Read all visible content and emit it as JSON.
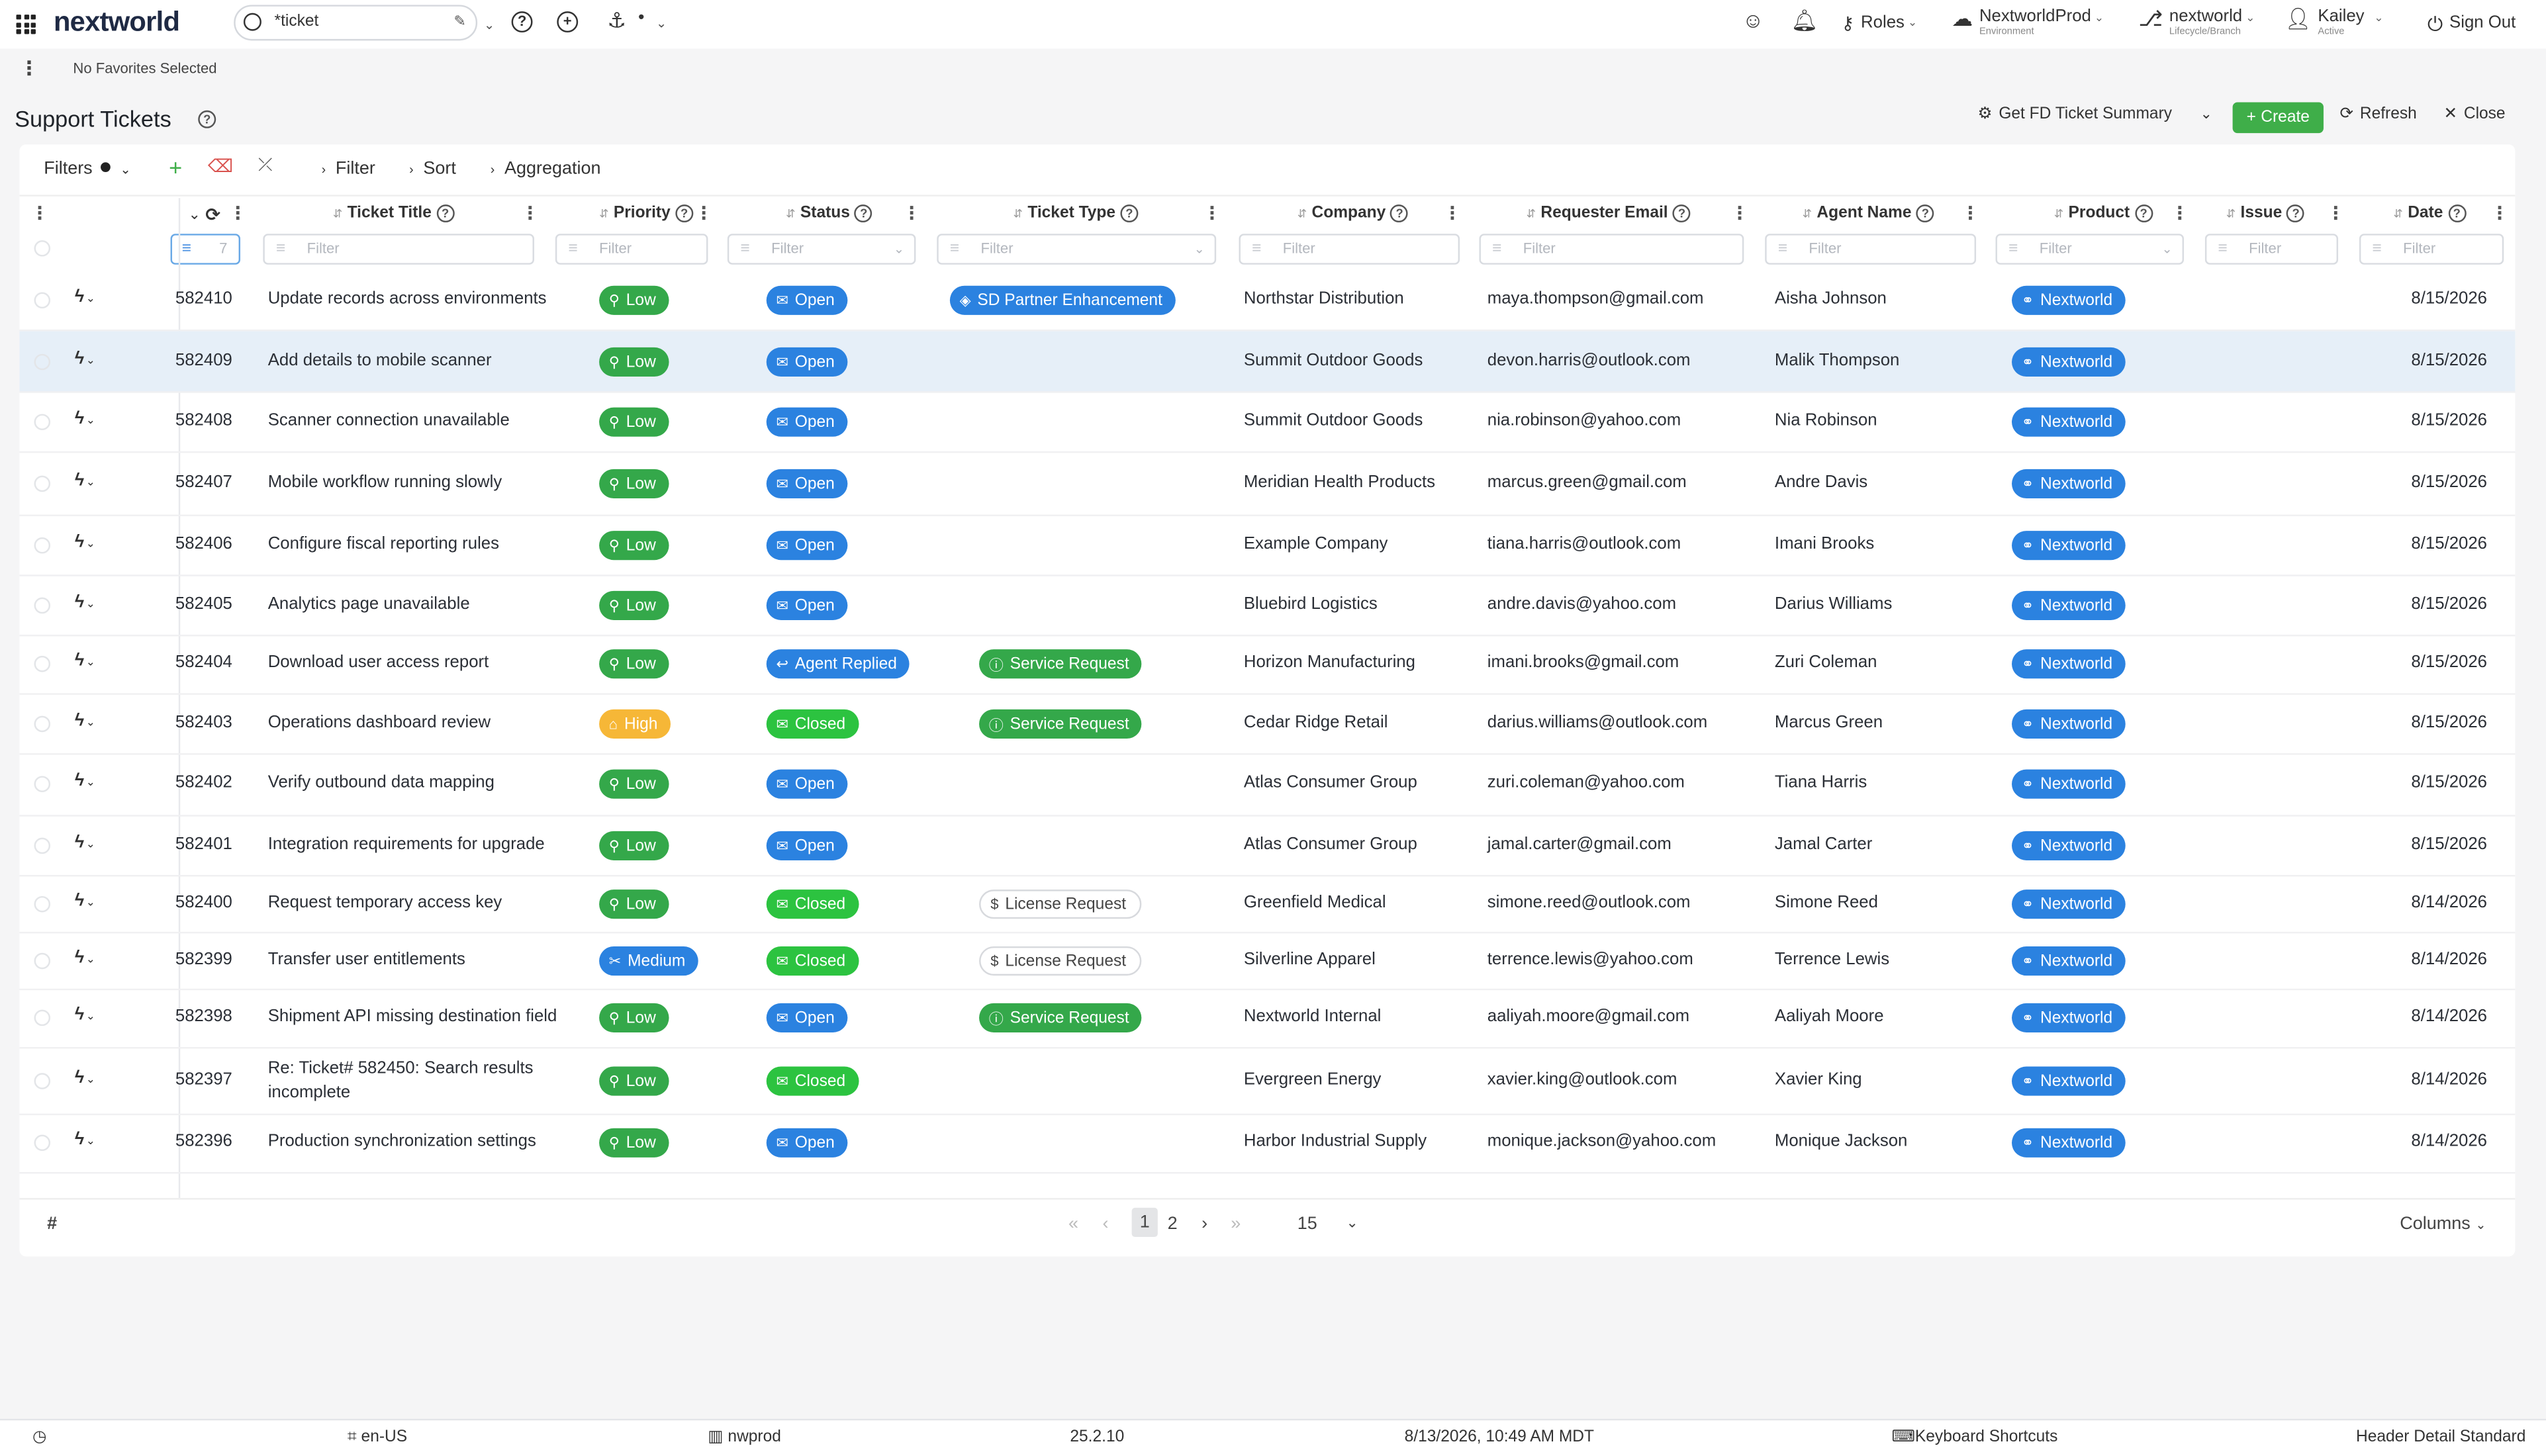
{
  "app": {
    "logo": "nextworld",
    "search_value": "*ticket",
    "roles": "Roles",
    "environment": {
      "name": "NextworldProd",
      "sub": "Environment"
    },
    "branch": {
      "name": "nextworld",
      "sub": "Lifecycle/Branch"
    },
    "user": {
      "name": "Kailey",
      "sub": "Active"
    },
    "sign_out": "Sign Out"
  },
  "favorites": "No Favorites Selected",
  "page": {
    "title": "Support Tickets",
    "summary_button": "Get FD Ticket Summary",
    "create": "Create",
    "refresh": "Refresh",
    "close": "Close"
  },
  "filters_bar": {
    "label": "Filters",
    "filter": "Filter",
    "sort": "Sort",
    "aggregation": "Aggregation"
  },
  "columns": {
    "title": "Ticket Title",
    "priority": "Priority",
    "status": "Status",
    "type": "Ticket Type",
    "company": "Company",
    "email": "Requester Email",
    "agent": "Agent Name",
    "product": "Product",
    "issue": "Issue",
    "date": "Date"
  },
  "filter_placeholder": "Filter",
  "id_filter_value": "7",
  "rows": [
    {
      "id": "582410",
      "title": "Update records across environments",
      "priority": "Low",
      "status": "Open",
      "type": "SD Partner Enhancement",
      "company": "Northstar Distribution",
      "email": "maya.thompson@gmail.com",
      "agent": "Aisha Johnson",
      "product": "Nextworld",
      "date": "8/15/2026"
    },
    {
      "id": "582409",
      "title": "Add details to mobile scanner",
      "priority": "Low",
      "status": "Open",
      "type": "",
      "company": "Summit Outdoor Goods",
      "email": "devon.harris@outlook.com",
      "agent": "Malik Thompson",
      "product": "Nextworld",
      "date": "8/15/2026"
    },
    {
      "id": "582408",
      "title": "Scanner connection unavailable",
      "priority": "Low",
      "status": "Open",
      "type": "",
      "company": "Summit Outdoor Goods",
      "email": "nia.robinson@yahoo.com",
      "agent": "Nia Robinson",
      "product": "Nextworld",
      "date": "8/15/2026"
    },
    {
      "id": "582407",
      "title": "Mobile workflow running slowly",
      "priority": "Low",
      "status": "Open",
      "type": "",
      "company": "Meridian Health Products",
      "email": "marcus.green@gmail.com",
      "agent": "Andre Davis",
      "product": "Nextworld",
      "date": "8/15/2026"
    },
    {
      "id": "582406",
      "title": "Configure fiscal reporting rules",
      "priority": "Low",
      "status": "Open",
      "type": "",
      "company": "Example Company",
      "email": "tiana.harris@outlook.com",
      "agent": "Imani Brooks",
      "product": "Nextworld",
      "date": "8/15/2026"
    },
    {
      "id": "582405",
      "title": "Analytics page unavailable",
      "priority": "Low",
      "status": "Open",
      "type": "",
      "company": "Bluebird Logistics",
      "email": "andre.davis@yahoo.com",
      "agent": "Darius Williams",
      "product": "Nextworld",
      "date": "8/15/2026"
    },
    {
      "id": "582404",
      "title": "Download user access report",
      "priority": "Low",
      "status": "Agent Replied",
      "type": "Service Request",
      "company": "Horizon Manufacturing",
      "email": "imani.brooks@gmail.com",
      "agent": "Zuri Coleman",
      "product": "Nextworld",
      "date": "8/15/2026"
    },
    {
      "id": "582403",
      "title": "Operations dashboard review",
      "priority": "High",
      "status": "Closed",
      "type": "Service Request",
      "company": "Cedar Ridge Retail",
      "email": "darius.williams@outlook.com",
      "agent": "Marcus Green",
      "product": "Nextworld",
      "date": "8/15/2026"
    },
    {
      "id": "582402",
      "title": "Verify outbound data mapping",
      "priority": "Low",
      "status": "Open",
      "type": "",
      "company": "Atlas Consumer Group",
      "email": "zuri.coleman@yahoo.com",
      "agent": "Tiana Harris",
      "product": "Nextworld",
      "date": "8/15/2026"
    },
    {
      "id": "582401",
      "title": "Integration requirements for upgrade",
      "priority": "Low",
      "status": "Open",
      "type": "",
      "company": "Atlas Consumer Group",
      "email": "jamal.carter@gmail.com",
      "agent": "Jamal Carter",
      "product": "Nextworld",
      "date": "8/15/2026"
    },
    {
      "id": "582400",
      "title": "Request temporary access key",
      "priority": "Low",
      "status": "Closed",
      "type": "License Request",
      "company": "Greenfield Medical",
      "email": "simone.reed@outlook.com",
      "agent": "Simone Reed",
      "product": "Nextworld",
      "date": "8/14/2026"
    },
    {
      "id": "582399",
      "title": "Transfer user entitlements",
      "priority": "Medium",
      "status": "Closed",
      "type": "License Request",
      "company": "Silverline Apparel",
      "email": "terrence.lewis@yahoo.com",
      "agent": "Terrence Lewis",
      "product": "Nextworld",
      "date": "8/14/2026"
    },
    {
      "id": "582398",
      "title": "Shipment API missing destination field",
      "priority": "Low",
      "status": "Open",
      "type": "Service Request",
      "company": "Nextworld Internal",
      "email": "aaliyah.moore@gmail.com",
      "agent": "Aaliyah Moore",
      "product": "Nextworld",
      "date": "8/14/2026"
    },
    {
      "id": "582397",
      "title": "Re: Ticket# 582450: Search results incomplete",
      "title_l1": "Re: Ticket# 582450: Search results",
      "title_l2": "incomplete",
      "priority": "Low",
      "status": "Closed",
      "type": "",
      "company": "Evergreen Energy",
      "email": "xavier.king@outlook.com",
      "agent": "Xavier King",
      "product": "Nextworld",
      "date": "8/14/2026"
    },
    {
      "id": "582396",
      "title": "Production synchronization settings",
      "priority": "Low",
      "status": "Open",
      "type": "",
      "company": "Harbor Industrial Supply",
      "email": "monique.jackson@yahoo.com",
      "agent": "Monique Jackson",
      "product": "Nextworld",
      "date": "8/14/2026"
    }
  ],
  "pager": {
    "hash": "#",
    "pages": [
      "1",
      "2"
    ],
    "page_size": "15",
    "columns": "Columns"
  },
  "statusbar": {
    "locale": "en-US",
    "env": "nwprod",
    "version": "25.2.10",
    "datetime": "8/13/2026, 10:49 AM MDT",
    "shortcuts": "Keyboard Shortcuts",
    "layout": "Header Detail Standard"
  },
  "colors": {
    "low": "#34a84a",
    "open": "#2b82e0",
    "closed": "#2cc340",
    "high": "#f6b737",
    "medium": "#2b82e0",
    "create": "#3fae49"
  }
}
